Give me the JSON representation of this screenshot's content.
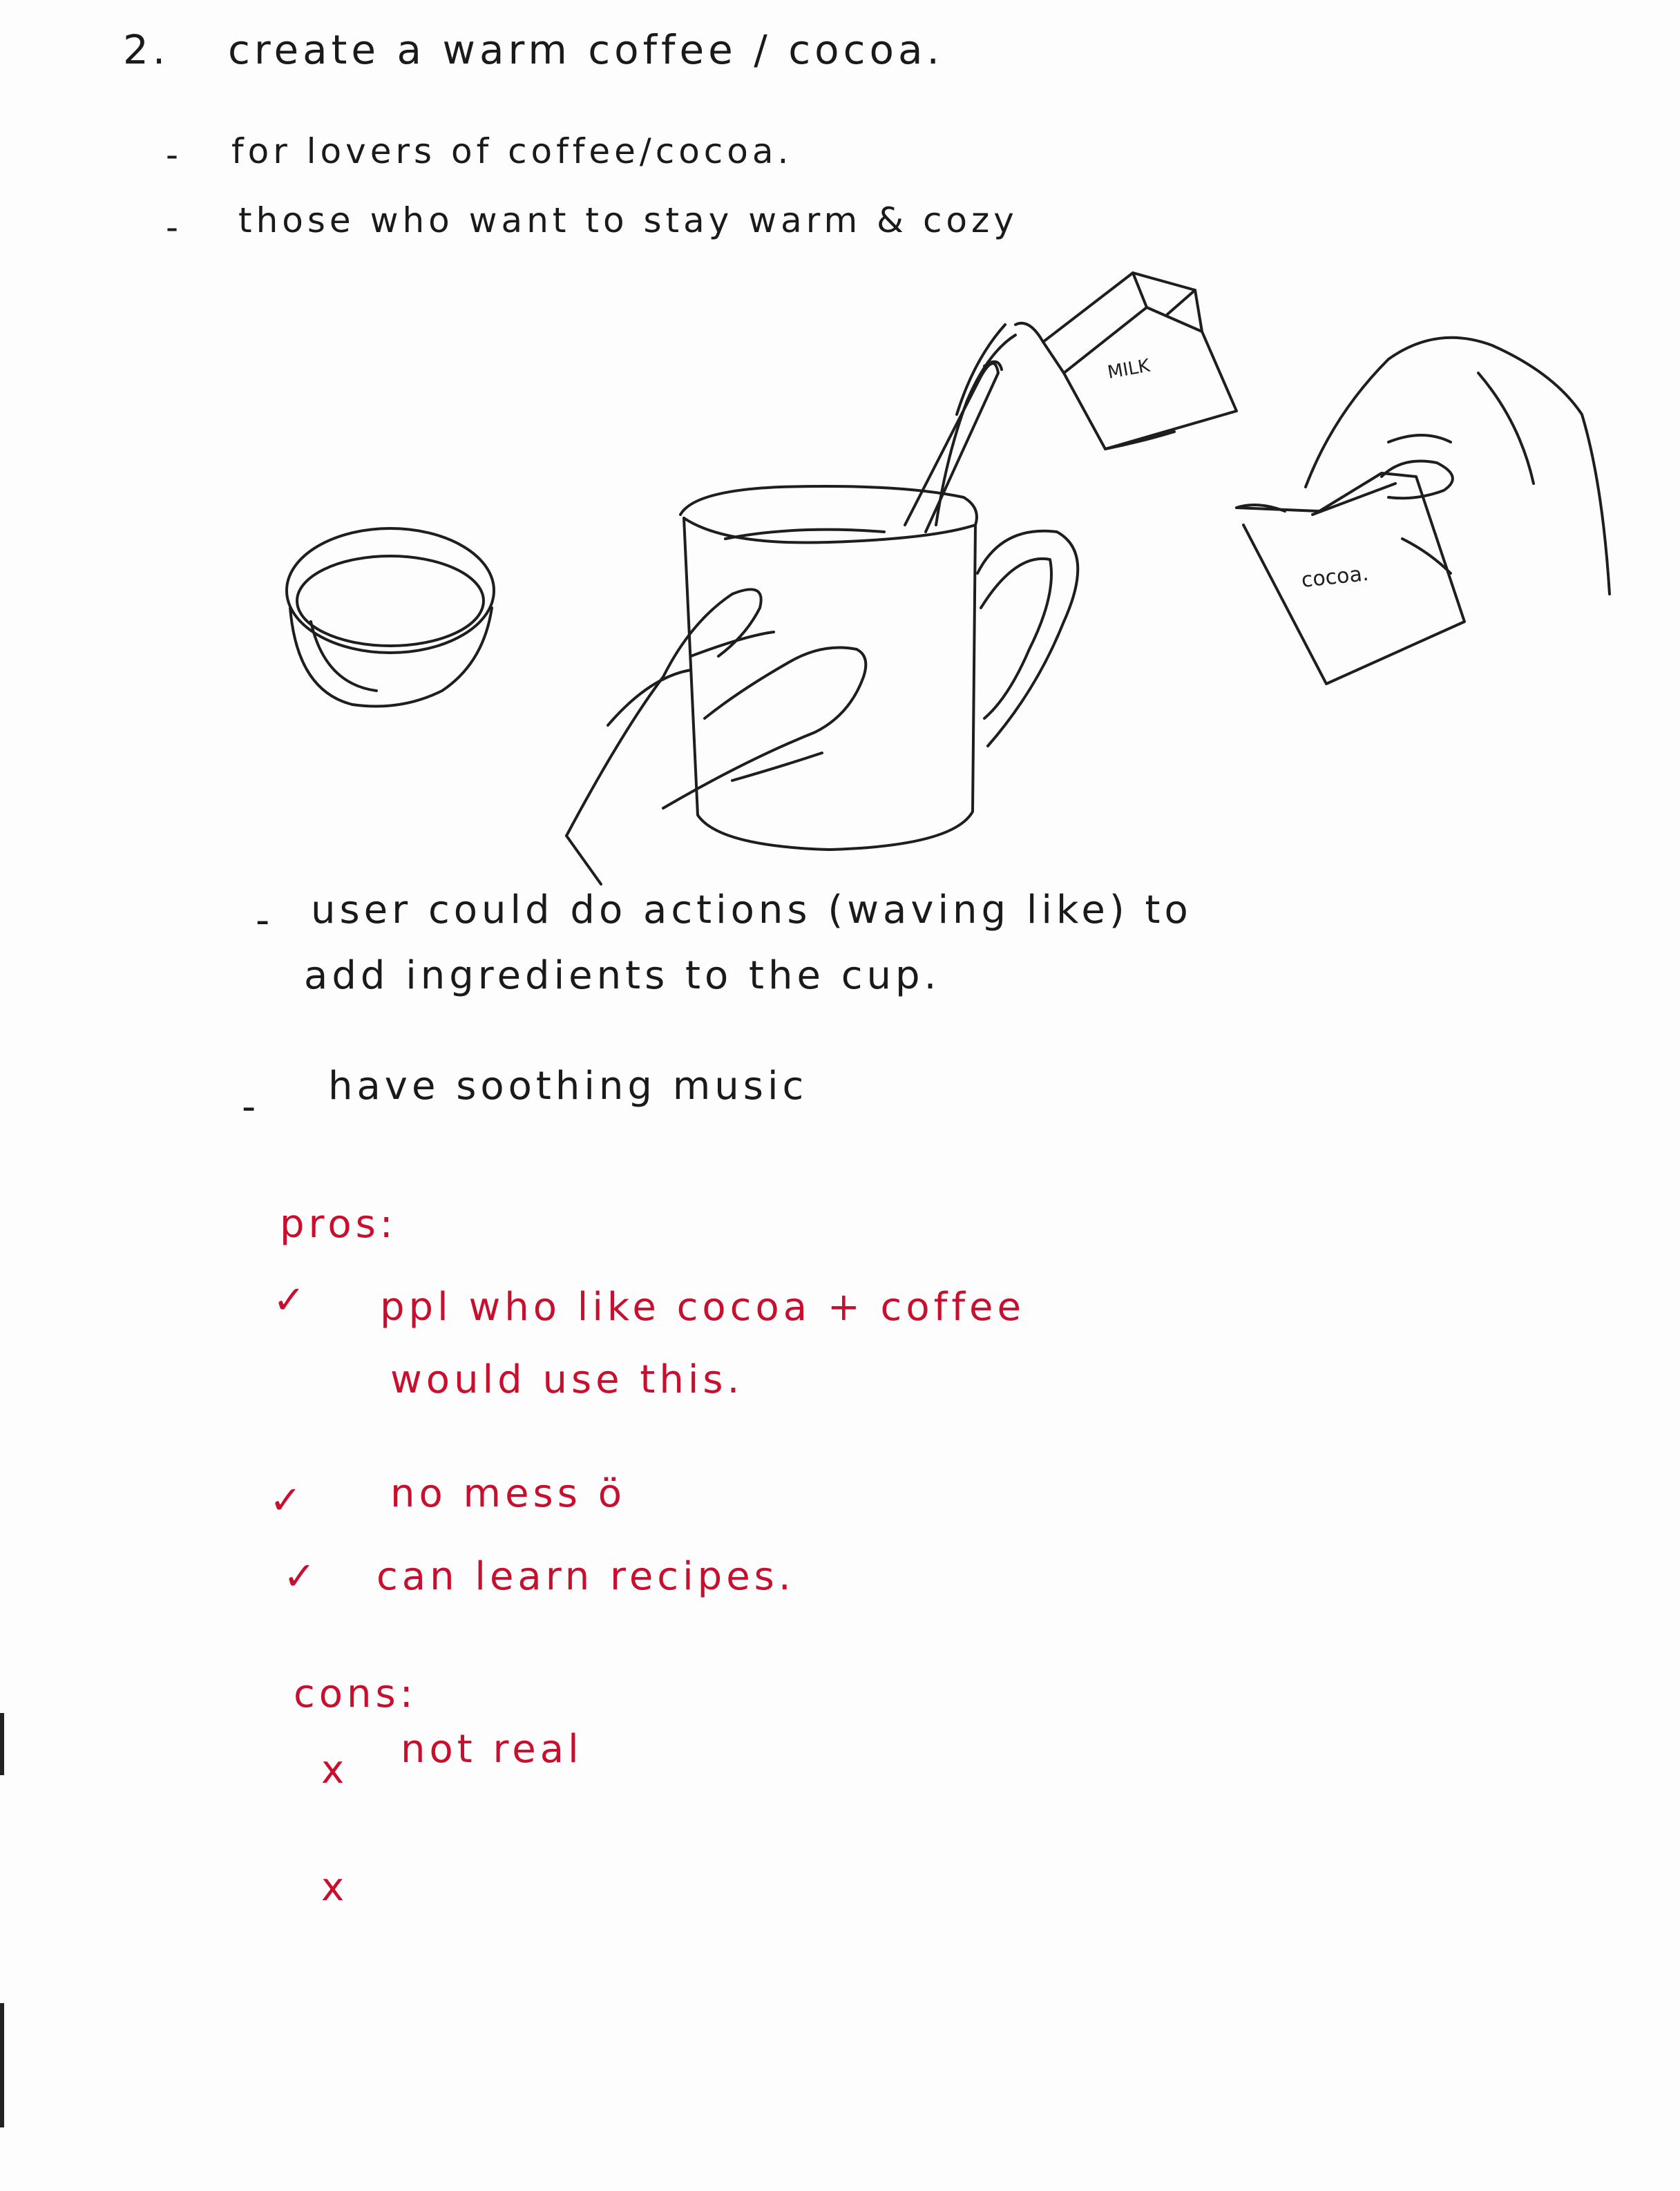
{
  "heading": {
    "number": "2.",
    "text": "create   a   warm  coffee / cocoa."
  },
  "audience": [
    {
      "bullet": "-",
      "text": "for   lovers  of   coffee/cocoa."
    },
    {
      "bullet": "-",
      "text": "those   who   want  to   stay  warm  &  cozy"
    }
  ],
  "sketch": {
    "milk_label": "MILK",
    "cocoa_label": "cocoa."
  },
  "notes": [
    {
      "bullet": "-",
      "line1": "user   could   do  actions  (waving like)  to",
      "line2": "add  ingredients   to   the  cup."
    },
    {
      "bullet": "-",
      "line1": "have   soothing   music"
    }
  ],
  "pros": {
    "heading": "pros:",
    "items": [
      {
        "mark": "✓",
        "line1": "ppl  who   like   cocoa  +   coffee",
        "line2": "would   use   this."
      },
      {
        "mark": "✓",
        "line1": "no    mess    ö"
      },
      {
        "mark": "✓",
        "line1": "can   learn  recipes."
      }
    ]
  },
  "cons": {
    "heading": "cons:",
    "items": [
      {
        "mark": "x",
        "text": "not   real"
      },
      {
        "mark": "x",
        "text": ""
      }
    ]
  }
}
